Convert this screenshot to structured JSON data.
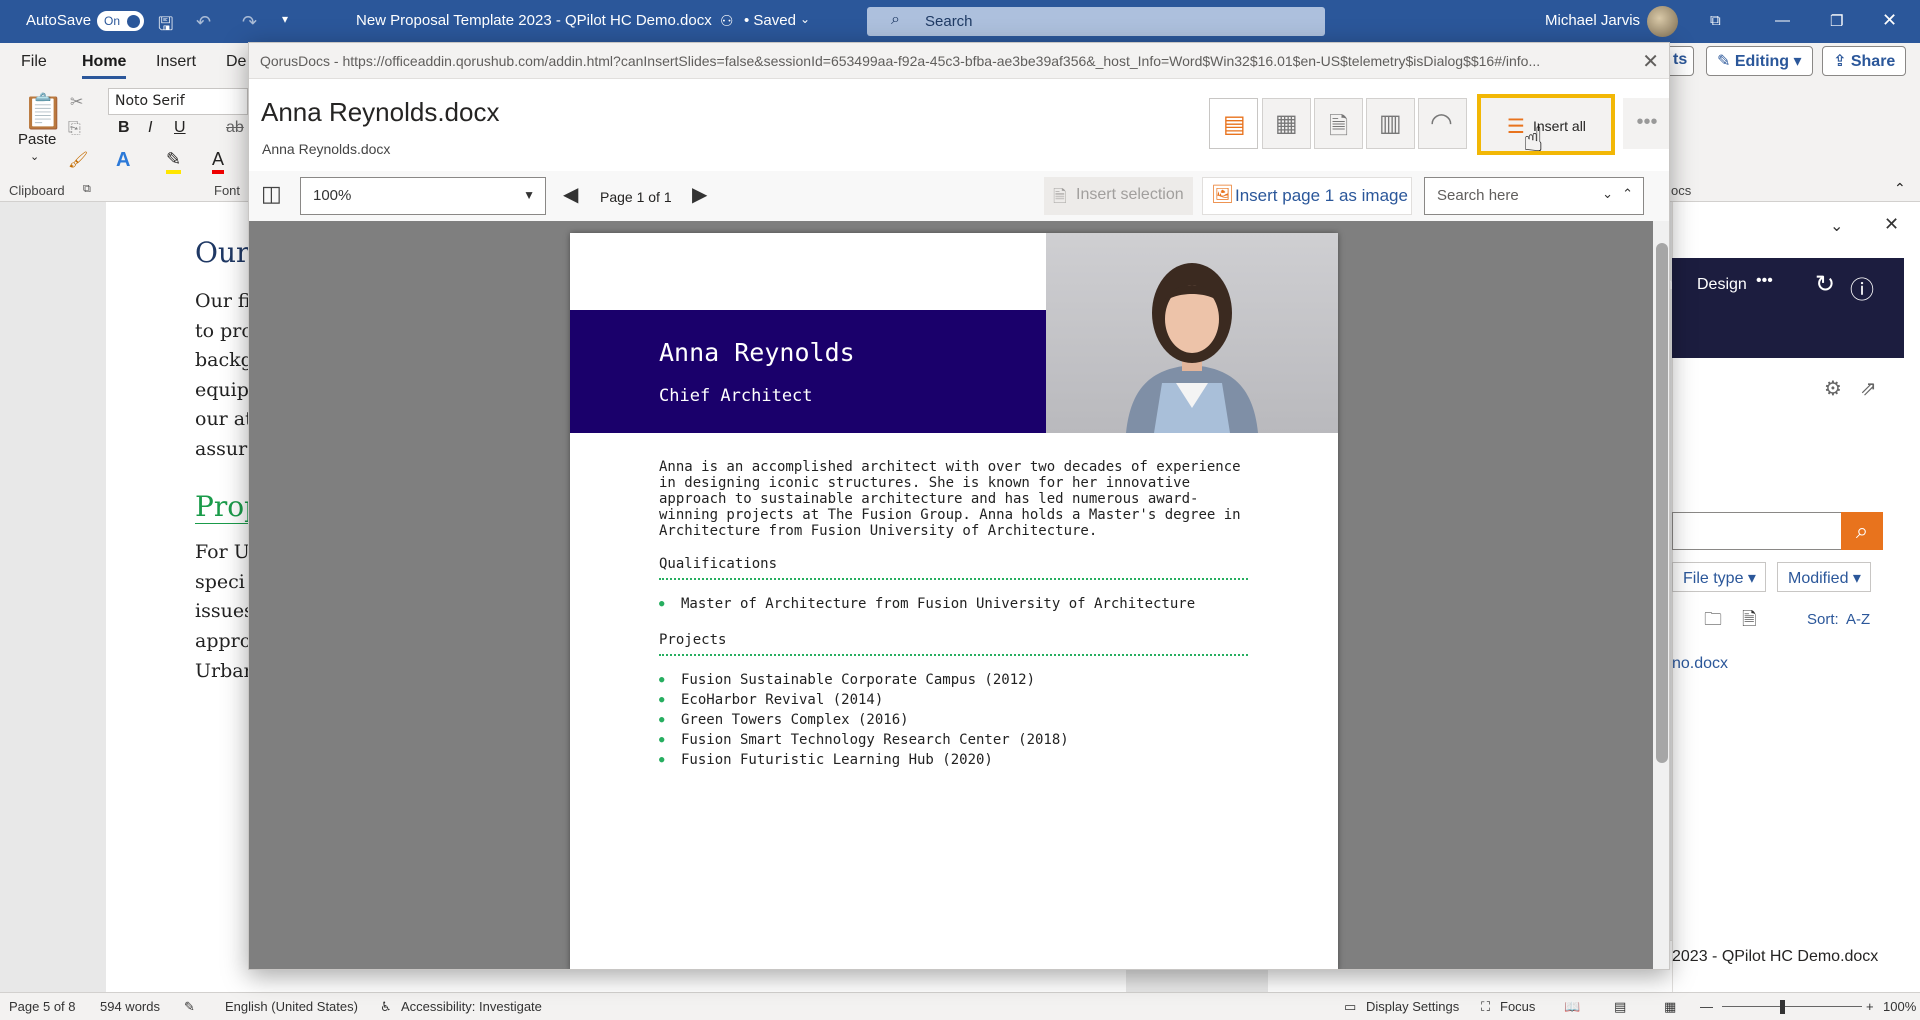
{
  "titlebar": {
    "autosave_label": "AutoSave",
    "autosave_state": "On",
    "doc_title": "New Proposal Template 2023 - QPilot HC Demo.docx",
    "saved_status": "• Saved",
    "search_placeholder": "Search",
    "user_name": "Michael Jarvis"
  },
  "ribbon": {
    "tabs": [
      "File",
      "Home",
      "Insert",
      "De"
    ],
    "font_name": "Noto Serif",
    "paste_label": "Paste",
    "clipboard_label": "Clipboard",
    "font_label": "Font",
    "ocs_label": "ocs",
    "right_tab_fragment": "ts",
    "editing_label": "Editing",
    "share_label": "Share"
  },
  "document": {
    "heading_1": "Our",
    "lines_1": [
      "Our fi",
      "to pro",
      "backg",
      "equip",
      "our at",
      "assur"
    ],
    "heading_2": "Prop",
    "lines_2": [
      "For U",
      "speci",
      "issues",
      "appro",
      "Urbar"
    ]
  },
  "side_panel": {
    "tab_fragment": "n",
    "design_label": "Design",
    "filetype_label": "File type",
    "modified_label": "Modified",
    "sort_label": "Sort:",
    "sort_value": "A-Z",
    "file_link": "no.docx",
    "footer_file": "2023 - QPilot HC Demo.docx"
  },
  "dialog": {
    "url": "QorusDocs - https://officeaddin.qorushub.com/addin.html?canInsertSlides=false&sessionId=653499aa-f92a-45c3-bfba-ae3be39af356&_host_Info=Word$Win32$16.01$en-US$telemetry$isDialog$$16#/info...",
    "file_title": "Anna Reynolds.docx",
    "file_subtitle": "Anna Reynolds.docx",
    "insert_all_label": "Insert all",
    "zoom_value": "100%",
    "page_indicator": "Page 1 of 1",
    "insert_selection_label": "Insert selection",
    "insert_page_label": "Insert page 1 as image",
    "search_placeholder": "Search here"
  },
  "cv": {
    "name": "Anna Reynolds",
    "role": "Chief Architect",
    "bio_lines": [
      "Anna is an accomplished architect with over two decades of experience",
      "in designing iconic structures. She is known for her innovative",
      "approach to sustainable architecture and has led numerous award-",
      "winning projects at The Fusion Group. Anna holds a Master's degree in",
      "Architecture from Fusion University of Architecture."
    ],
    "qualifications_heading": "Qualifications",
    "qualifications": [
      "Master of Architecture from Fusion University of Architecture"
    ],
    "projects_heading": "Projects",
    "projects": [
      "Fusion Sustainable Corporate Campus (2012)",
      "EcoHarbor Revival (2014)",
      "Green Towers Complex (2016)",
      "Fusion Smart Technology Research Center (2018)",
      "Fusion Futuristic Learning Hub (2020)"
    ]
  },
  "statusbar": {
    "page": "Page 5 of 8",
    "words": "594 words",
    "language": "English (United States)",
    "accessibility": "Accessibility: Investigate",
    "display_settings": "Display Settings",
    "focus": "Focus",
    "zoom": "100%"
  },
  "colors": {
    "word_blue": "#2b579a",
    "banner_navy": "#1a006b",
    "bullet_green": "#27ae60",
    "highlight_yellow": "#f2b705",
    "search_orange": "#e8731d"
  }
}
